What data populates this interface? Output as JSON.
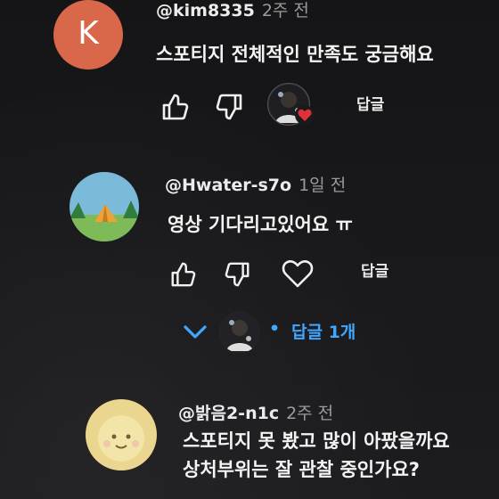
{
  "comments": [
    {
      "avatar_letter": "K",
      "handle": "@kim8335",
      "time": "2주 전",
      "text": "스포티지 전체적인 만족도 궁금해요",
      "reply_label": "답글"
    },
    {
      "handle": "@Hwater-s7o",
      "time": "1일 전",
      "text": "영상 기다리고있어요 ㅠ",
      "reply_label": "답글",
      "replies_toggle": "답글 1개",
      "bullet": "•"
    },
    {
      "handle": "@밝음2-n1c",
      "time": "2주 전",
      "lines": [
        "스포티지 못 봤고 많이 아팠을까요",
        "상처부위는 잘 관찰 중인가요?"
      ]
    }
  ],
  "colors": {
    "background": "#18181a",
    "accent_blue": "#3ea6ff",
    "heart_red": "#e0303a",
    "avatar_k": "#d9674a"
  },
  "icons": [
    "like-icon",
    "dislike-icon",
    "heart-icon",
    "chevron-down-icon"
  ]
}
